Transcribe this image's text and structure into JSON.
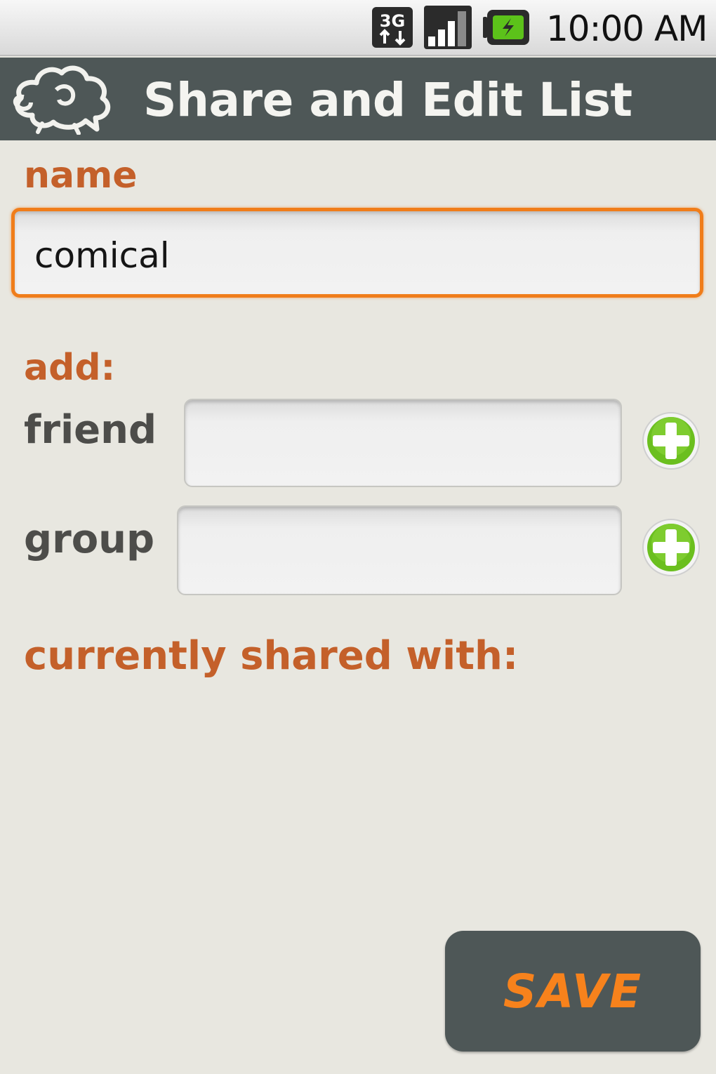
{
  "status_bar": {
    "time": "10:00 AM",
    "icons": [
      "3g-data-icon",
      "signal-strength-icon",
      "battery-charging-icon"
    ],
    "network_label": "3G"
  },
  "header": {
    "title": "Share and Edit List",
    "logo": "sheep-logo-icon"
  },
  "form": {
    "name_label": "name",
    "name_value": "comical",
    "add_label": "add:",
    "friend_label": "friend",
    "friend_value": "",
    "group_label": "group",
    "group_value": "",
    "add_icon": "plus-circle-icon",
    "shared_label": "currently shared with:",
    "shared_list": []
  },
  "actions": {
    "save_label": "SAVE"
  },
  "colors": {
    "accent": "#c4602a",
    "focus_border": "#f07d1a",
    "header_bg": "#4e5757",
    "add_green": "#6bbf1f",
    "save_text": "#f7821c",
    "background": "#e8e7e0"
  }
}
